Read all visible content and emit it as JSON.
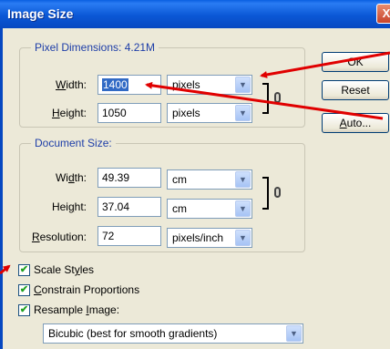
{
  "dialog": {
    "title": "Image Size",
    "close_glyph": "X"
  },
  "pixel_dimensions": {
    "legend": "Pixel Dimensions:  4.21M",
    "width_label_u": "W",
    "width_label_rest": "idth:",
    "width_value": "1400",
    "width_unit": "pixels",
    "height_label_u": "H",
    "height_label_rest": "eight:",
    "height_value": "1050",
    "height_unit": "pixels"
  },
  "document_size": {
    "legend": "Document Size:",
    "width_label_pre": "Wi",
    "width_label_u": "d",
    "width_label_rest": "th:",
    "width_value": "49.39",
    "width_unit": "cm",
    "height_label_pre": "Hei",
    "height_label_u": "g",
    "height_label_rest": "ht:",
    "height_value": "37.04",
    "height_unit": "cm",
    "resolution_label_u": "R",
    "resolution_label_rest": "esolution:",
    "resolution_value": "72",
    "resolution_unit": "pixels/inch"
  },
  "buttons": {
    "ok": "OK",
    "reset": "Reset",
    "auto_u": "A",
    "auto_rest": "uto..."
  },
  "options": {
    "scale_styles_pre": "Scale St",
    "scale_styles_u": "y",
    "scale_styles_rest": "les",
    "constrain_u": "C",
    "constrain_rest": "onstrain Proportions",
    "resample_pre": "Resample ",
    "resample_u": "I",
    "resample_rest": "mage:",
    "resample_method": "Bicubic (best for smooth gradients)",
    "checked_glyph": "✔"
  },
  "colors": {
    "titlebar": "#0b58d6",
    "annotation_arrow": "#e00000",
    "legend": "#1e3ea8"
  },
  "icons": {
    "dropdown": "chevron-down-icon",
    "link": "chain-link-icon"
  }
}
